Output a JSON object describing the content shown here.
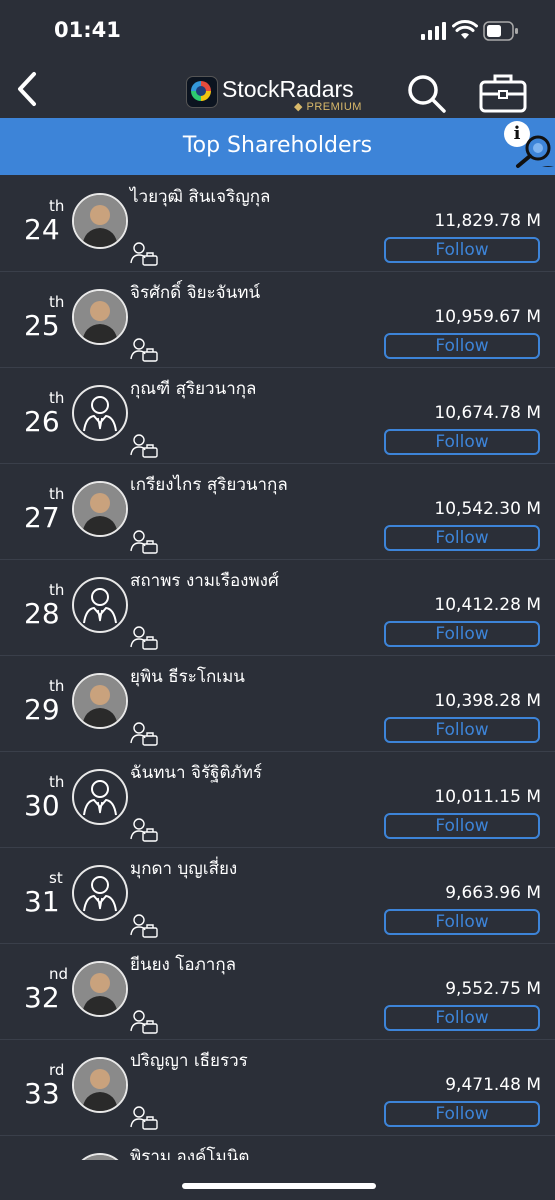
{
  "status_bar": {
    "time": "01:41"
  },
  "nav": {
    "brand": "StockRadars",
    "brand_sub": "PREMIUM",
    "icons": [
      "back-arrow-icon",
      "search-icon",
      "briefcase-icon"
    ]
  },
  "page": {
    "title": "Top Shareholders"
  },
  "colors": {
    "accent": "#3d84d8",
    "background": "#2b2f38"
  },
  "shareholders": [
    {
      "rank": "24",
      "suffix": "th",
      "name": "ไวยวุฒิ สินเจริญกุล",
      "value": "11,829.78 M",
      "follow": "Follow",
      "avatar": "photo"
    },
    {
      "rank": "25",
      "suffix": "th",
      "name": "จิรศักดิ์ จิยะจันทน์",
      "value": "10,959.67 M",
      "follow": "Follow",
      "avatar": "photo"
    },
    {
      "rank": "26",
      "suffix": "th",
      "name": "กุณฑี สุริยวนากุล",
      "value": "10,674.78 M",
      "follow": "Follow",
      "avatar": "default"
    },
    {
      "rank": "27",
      "suffix": "th",
      "name": "เกรียงไกร สุริยวนากุล",
      "value": "10,542.30 M",
      "follow": "Follow",
      "avatar": "photo"
    },
    {
      "rank": "28",
      "suffix": "th",
      "name": "สถาพร งามเรืองพงศ์",
      "value": "10,412.28 M",
      "follow": "Follow",
      "avatar": "default"
    },
    {
      "rank": "29",
      "suffix": "th",
      "name": "ยุพิน ธีระโกเมน",
      "value": "10,398.28 M",
      "follow": "Follow",
      "avatar": "photo"
    },
    {
      "rank": "30",
      "suffix": "th",
      "name": "ฉันทนา จิรัฐิติภัทร์",
      "value": "10,011.15 M",
      "follow": "Follow",
      "avatar": "default"
    },
    {
      "rank": "31",
      "suffix": "st",
      "name": "มุกดา บุญเสี่ยง",
      "value": "9,663.96 M",
      "follow": "Follow",
      "avatar": "default"
    },
    {
      "rank": "32",
      "suffix": "nd",
      "name": "ยีนยง โอภากุล",
      "value": "9,552.75 M",
      "follow": "Follow",
      "avatar": "photo"
    },
    {
      "rank": "33",
      "suffix": "rd",
      "name": "ปริญญา เธียรวร",
      "value": "9,471.48 M",
      "follow": "Follow",
      "avatar": "photo"
    },
    {
      "rank": "",
      "suffix": "",
      "name": "พิราม องค์โมนิต",
      "value": "",
      "follow": "",
      "avatar": "photo"
    }
  ]
}
